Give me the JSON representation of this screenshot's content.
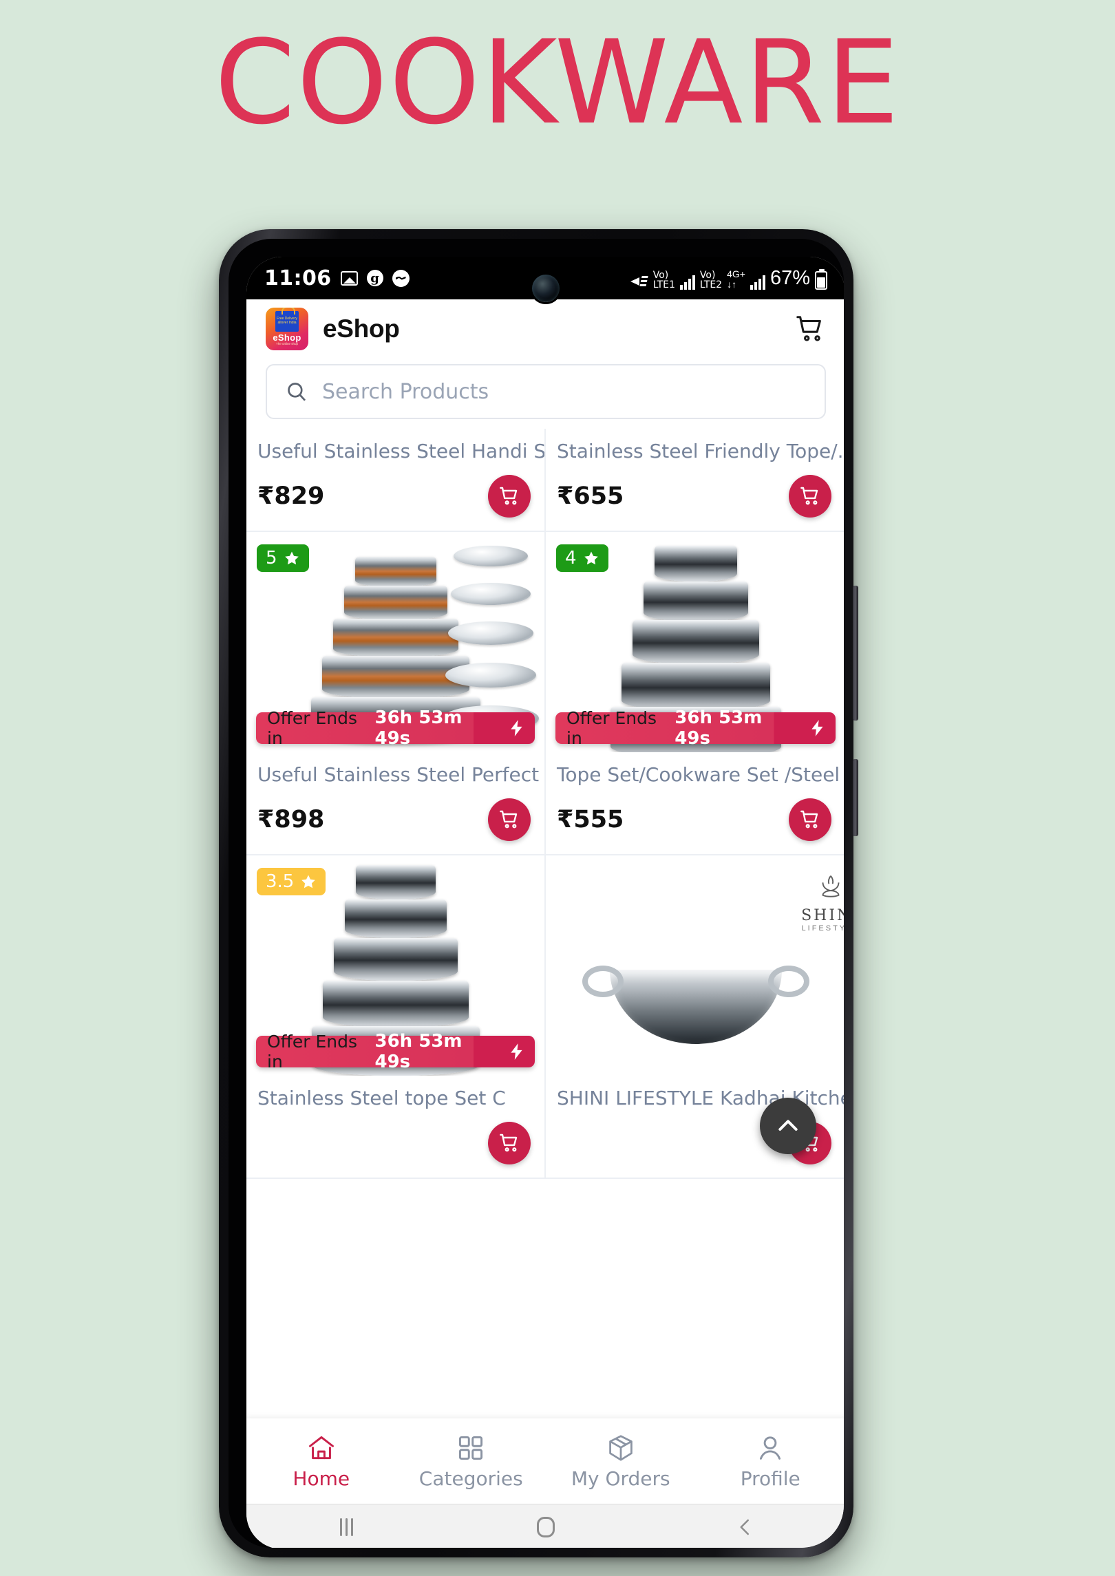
{
  "poster": {
    "title": "COOKWARE",
    "background_color": "#d7e8da",
    "title_color": "#dd3355"
  },
  "status_bar": {
    "time": "11:06",
    "icons_left": [
      "photos-icon",
      "google-icon",
      "messenger-icon"
    ],
    "g_letter": "g",
    "mute": "mute-icon",
    "sim1_volte_top": "Vo)",
    "sim1_volte_bottom": "LTE1",
    "sim2_volte_top": "Vo)",
    "sim2_volte_bottom": "LTE2",
    "network": "4G+",
    "data_arrows": "↓↑",
    "battery_percent": "67%"
  },
  "app_bar": {
    "logo_bag_text": "Free Delivery allover India",
    "logo_word": "eShop",
    "logo_tagline": "The online shop",
    "title": "eShop",
    "cart_icon": "cart-icon"
  },
  "search": {
    "placeholder": "Search Products",
    "value": "",
    "icon": "search-icon"
  },
  "products": [
    {
      "name": "Useful Stainless Steel Handi S...",
      "price": "₹829",
      "rating": null,
      "offer": null,
      "cut_off_top": true
    },
    {
      "name": "Stainless Steel Friendly Tope/...",
      "price": "₹655",
      "rating": null,
      "offer": null,
      "cut_off_top": true
    },
    {
      "name": "Useful Stainless Steel Perfect ...",
      "price": "₹898",
      "rating": "5",
      "rating_color": "#1d9b16",
      "offer_label": "Offer Ends in",
      "offer_time": "36h 53m 49s"
    },
    {
      "name": "Tope Set/Cookware Set /Steel ...",
      "price": "₹555",
      "rating": "4",
      "rating_color": "#1d9b16",
      "offer_label": "Offer Ends in",
      "offer_time": "36h 53m 49s"
    },
    {
      "name": "Stainless Steel tope Set C",
      "price": "",
      "rating": "3.5",
      "rating_color": "#fcc63f",
      "offer_label": "Offer Ends in",
      "offer_time": "36h 53m 49s"
    },
    {
      "name": "SHINI LIFESTYLE Kadhai Kitche...",
      "price": "",
      "rating": null,
      "watermark_line1": "SHINI",
      "watermark_line2": "LIFESTYLE"
    }
  ],
  "fab": {
    "icon": "scroll-to-top-icon"
  },
  "bottom_nav": {
    "active_color": "#c9204a",
    "inactive_color": "#8b94a3",
    "items": [
      {
        "label": "Home",
        "icon": "home-icon",
        "active": true
      },
      {
        "label": "Categories",
        "icon": "grid-icon",
        "active": false
      },
      {
        "label": "My Orders",
        "icon": "package-icon",
        "active": false
      },
      {
        "label": "Profile",
        "icon": "person-icon",
        "active": false
      }
    ]
  },
  "android_nav": {
    "recents": "recents-icon",
    "home": "home-circle-icon",
    "back": "back-chevron-icon"
  }
}
